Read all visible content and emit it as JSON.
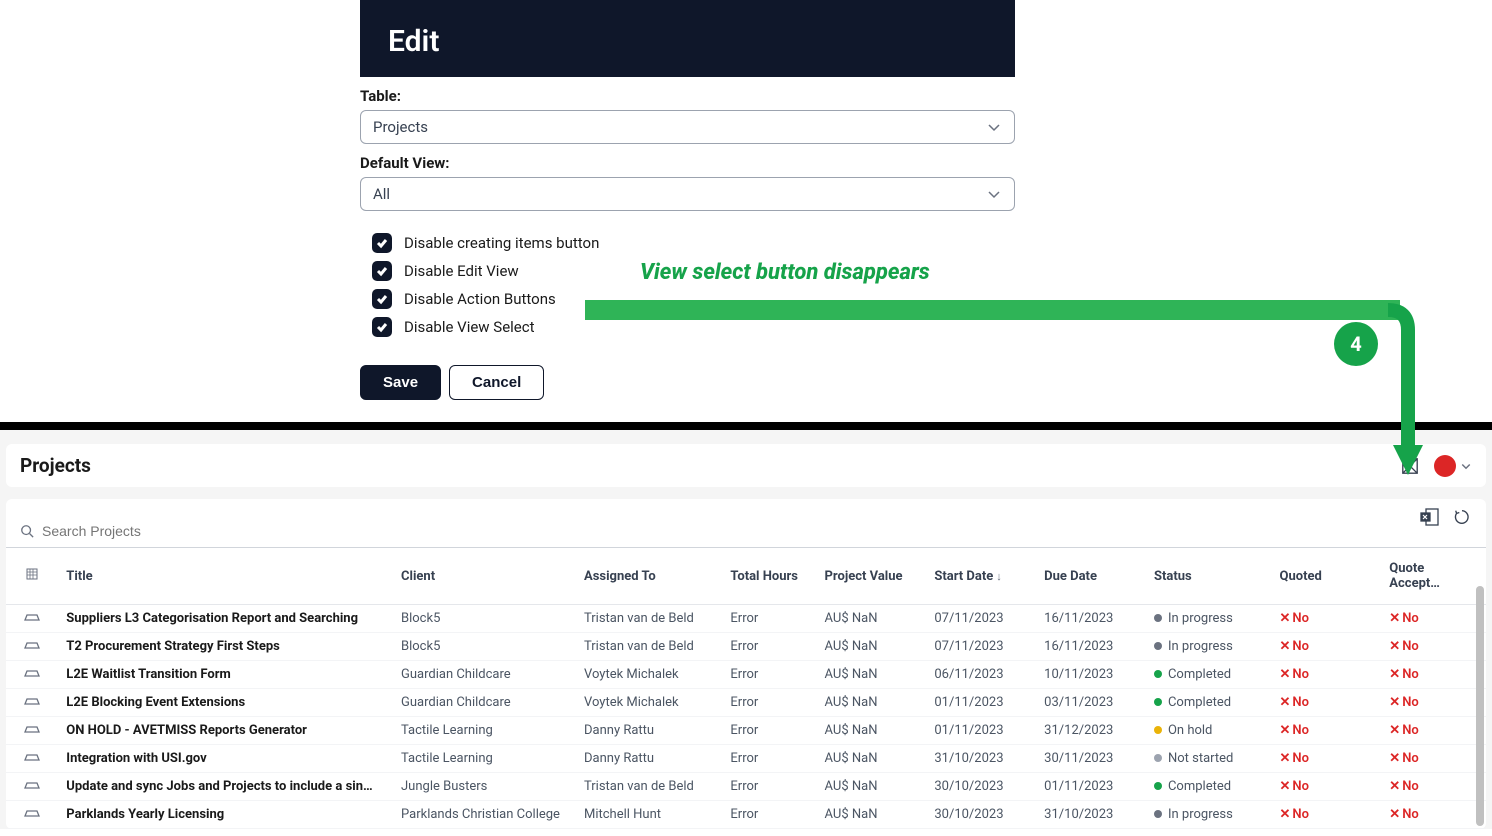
{
  "edit": {
    "title": "Edit",
    "table_label": "Table:",
    "table_value": "Projects",
    "view_label": "Default View:",
    "view_value": "All",
    "checkboxes": [
      {
        "label": "Disable creating items button",
        "checked": true
      },
      {
        "label": "Disable Edit View",
        "checked": true
      },
      {
        "label": "Disable Action Buttons",
        "checked": true
      },
      {
        "label": "Disable View Select",
        "checked": true
      }
    ],
    "save": "Save",
    "cancel": "Cancel"
  },
  "annotation": {
    "text": "View select button disappears",
    "badge": "4"
  },
  "page": {
    "title": "Projects",
    "search_placeholder": "Search Projects"
  },
  "columns": {
    "title": "Title",
    "client": "Client",
    "assigned": "Assigned To",
    "hours": "Total Hours",
    "value": "Project Value",
    "start": "Start Date",
    "due": "Due Date",
    "status": "Status",
    "quoted": "Quoted",
    "accept": "Quote Accept…"
  },
  "rows": [
    {
      "title": "Suppliers L3 Categorisation Report and Searching",
      "client": "Block5",
      "assigned": "Tristan van de Beld",
      "hours": "Error",
      "value": "AU$ NaN",
      "start": "07/11/2023",
      "due": "16/11/2023",
      "status": "In progress",
      "status_class": "dot-progress",
      "quoted": "No",
      "accept": "No"
    },
    {
      "title": "T2 Procurement Strategy First Steps",
      "client": "Block5",
      "assigned": "Tristan van de Beld",
      "hours": "Error",
      "value": "AU$ NaN",
      "start": "07/11/2023",
      "due": "16/11/2023",
      "status": "In progress",
      "status_class": "dot-progress",
      "quoted": "No",
      "accept": "No"
    },
    {
      "title": "L2E Waitlist Transition Form",
      "client": "Guardian Childcare",
      "assigned": "Voytek Michalek",
      "hours": "Error",
      "value": "AU$ NaN",
      "start": "06/11/2023",
      "due": "10/11/2023",
      "status": "Completed",
      "status_class": "dot-completed",
      "quoted": "No",
      "accept": "No"
    },
    {
      "title": "L2E Blocking Event Extensions",
      "client": "Guardian Childcare",
      "assigned": "Voytek Michalek",
      "hours": "Error",
      "value": "AU$ NaN",
      "start": "01/11/2023",
      "due": "03/11/2023",
      "status": "Completed",
      "status_class": "dot-completed",
      "quoted": "No",
      "accept": "No"
    },
    {
      "title": "ON HOLD - AVETMISS Reports Generator",
      "client": "Tactile Learning",
      "assigned": "Danny Rattu",
      "hours": "Error",
      "value": "AU$ NaN",
      "start": "01/11/2023",
      "due": "31/12/2023",
      "status": "On hold",
      "status_class": "dot-hold",
      "quoted": "No",
      "accept": "No"
    },
    {
      "title": "Integration with USI.gov",
      "client": "Tactile Learning",
      "assigned": "Danny Rattu",
      "hours": "Error",
      "value": "AU$ NaN",
      "start": "31/10/2023",
      "due": "30/11/2023",
      "status": "Not started",
      "status_class": "dot-notstarted",
      "quoted": "No",
      "accept": "No"
    },
    {
      "title": "Update and sync Jobs and Projects to include a sin…",
      "client": "Jungle Busters",
      "assigned": "Tristan van de Beld",
      "hours": "Error",
      "value": "AU$ NaN",
      "start": "30/10/2023",
      "due": "01/11/2023",
      "status": "Completed",
      "status_class": "dot-completed",
      "quoted": "No",
      "accept": "No"
    },
    {
      "title": "Parklands Yearly Licensing",
      "client": "Parklands Christian College",
      "assigned": "Mitchell Hunt",
      "hours": "Error",
      "value": "AU$ NaN",
      "start": "30/10/2023",
      "due": "31/10/2023",
      "status": "In progress",
      "status_class": "dot-progress",
      "quoted": "No",
      "accept": "No"
    }
  ]
}
